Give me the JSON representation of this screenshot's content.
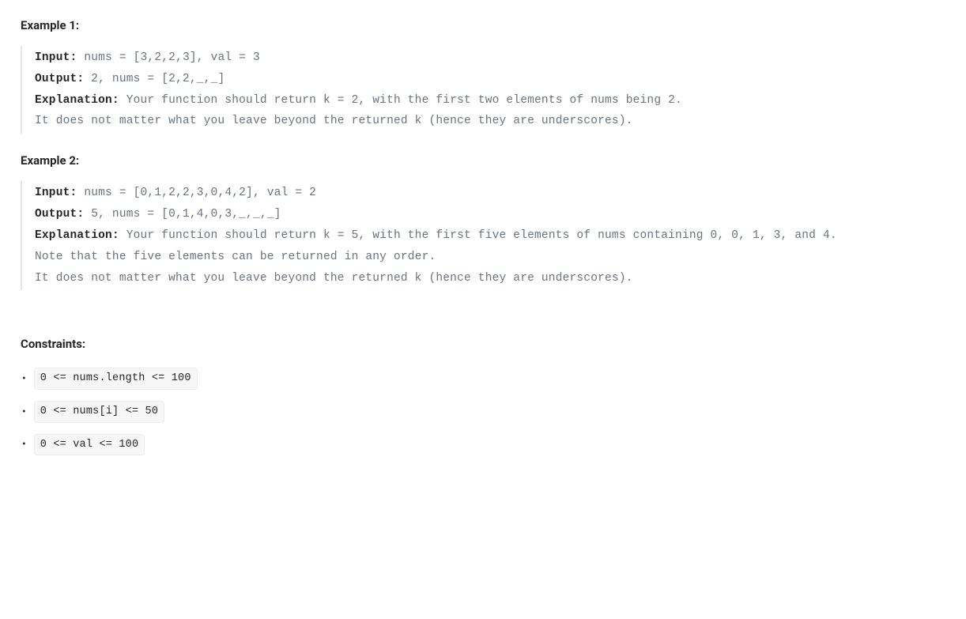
{
  "example1": {
    "heading": "Example 1:",
    "input_label": "Input:",
    "input_text": " nums = [3,2,2,3], val = 3",
    "output_label": "Output:",
    "output_text": " 2, nums = [2,2,_,_]",
    "explanation_label": "Explanation:",
    "explanation_line1": " Your function should return k = 2, with the first two elements of nums being 2.",
    "explanation_line2": "It does not matter what you leave beyond the returned k (hence they are underscores)."
  },
  "example2": {
    "heading": "Example 2:",
    "input_label": "Input:",
    "input_text": " nums = [0,1,2,2,3,0,4,2], val = 2",
    "output_label": "Output:",
    "output_text": " 5, nums = [0,1,4,0,3,_,_,_]",
    "explanation_label": "Explanation:",
    "explanation_line1": " Your function should return k = 5, with the first five elements of nums containing 0, 0, 1, 3, and 4.",
    "explanation_line2": "Note that the five elements can be returned in any order.",
    "explanation_line3": "It does not matter what you leave beyond the returned k (hence they are underscores)."
  },
  "constraints": {
    "heading": "Constraints:",
    "items": [
      "0 <= nums.length <= 100",
      "0 <= nums[i] <= 50",
      "0 <= val <= 100"
    ]
  }
}
